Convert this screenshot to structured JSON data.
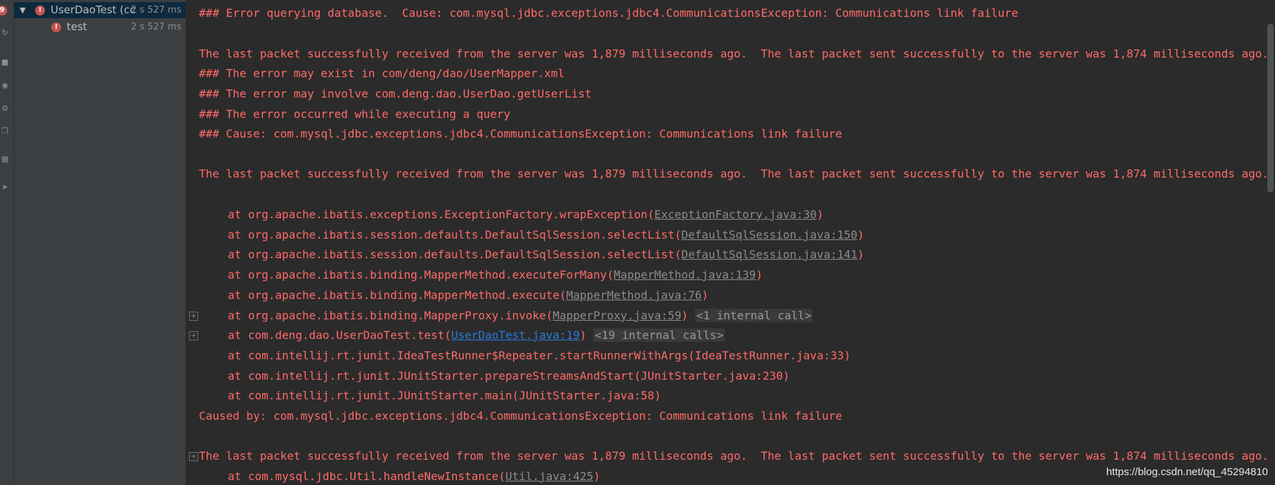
{
  "toolbar": {
    "icons": [
      "error-badge",
      "rerun-icon",
      "stop-icon",
      "camera-icon",
      "settings-icon",
      "export-icon",
      "layout-icon",
      "pin-icon"
    ],
    "error_badge_label": "9"
  },
  "test_tree": {
    "root": {
      "name": "UserDaoTest (cc",
      "time": "2 s 527 ms"
    },
    "children": [
      {
        "name": "test",
        "time": "2 s 527 ms"
      }
    ]
  },
  "console": {
    "lines": [
      {
        "text": "### Error querying database.  Cause: com.mysql.jdbc.exceptions.jdbc4.CommunicationsException: Communications link failure"
      },
      {
        "text": "The last packet successfully received from the server was 1,879 milliseconds ago.  The last packet sent successfully to the server was 1,874 milliseconds ago."
      },
      {
        "text": "### The error may exist in com/deng/dao/UserMapper.xml"
      },
      {
        "text": "### The error may involve com.deng.dao.UserDao.getUserList"
      },
      {
        "text": "### The error occurred while executing a query"
      },
      {
        "text": "### Cause: com.mysql.jdbc.exceptions.jdbc4.CommunicationsException: Communications link failure"
      },
      {
        "text": "The last packet successfully received from the server was 1,879 milliseconds ago.  The last packet sent successfully to the server was 1,874 milliseconds ago."
      }
    ],
    "stack": [
      {
        "prefix": "at org.apache.ibatis.exceptions.ExceptionFactory.wrapException(",
        "link": "ExceptionFactory.java:30",
        "suffix": ")"
      },
      {
        "prefix": "at org.apache.ibatis.session.defaults.DefaultSqlSession.selectList(",
        "link": "DefaultSqlSession.java:150",
        "suffix": ")"
      },
      {
        "prefix": "at org.apache.ibatis.session.defaults.DefaultSqlSession.selectList(",
        "link": "DefaultSqlSession.java:141",
        "suffix": ")"
      },
      {
        "prefix": "at org.apache.ibatis.binding.MapperMethod.executeForMany(",
        "link": "MapperMethod.java:139",
        "suffix": ")"
      },
      {
        "prefix": "at org.apache.ibatis.binding.MapperMethod.execute(",
        "link": "MapperMethod.java:76",
        "suffix": ")"
      },
      {
        "prefix": "at org.apache.ibatis.binding.MapperProxy.invoke(",
        "link": "MapperProxy.java:59",
        "suffix": ")",
        "fold": "<1 internal call>"
      },
      {
        "prefix": "at com.deng.dao.UserDaoTest.test(",
        "link": "UserDaoTest.java:19",
        "suffix": ")",
        "fold": "<19 internal calls>"
      },
      {
        "text": "at com.intellij.rt.junit.IdeaTestRunner$Repeater.startRunnerWithArgs(IdeaTestRunner.java:33)"
      },
      {
        "text": "at com.intellij.rt.junit.JUnitStarter.prepareStreamsAndStart(JUnitStarter.java:230)"
      },
      {
        "text": "at com.intellij.rt.junit.JUnitStarter.main(JUnitStarter.java:58)"
      }
    ],
    "caused_by": "Caused by: com.mysql.jdbc.exceptions.jdbc4.CommunicationsException: Communications link failure",
    "last_packet": "The last packet successfully received from the server was 1,879 milliseconds ago.  The last packet sent successfully to the server was 1,874 milliseconds ago.",
    "util_stack": {
      "prefix": "at com.mysql.jdbc.Util.handleNewInstance(",
      "link": "Util.java:425",
      "suffix": ")"
    },
    "fold_plus": "+"
  },
  "watermark": "https://blog.csdn.net/qq_45294810"
}
